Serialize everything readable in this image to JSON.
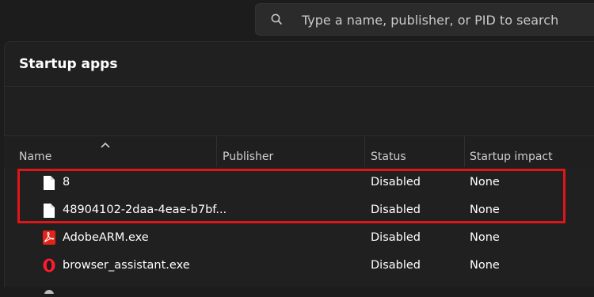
{
  "search": {
    "placeholder": "Type a name, publisher, or PID to search"
  },
  "page": {
    "title": "Startup apps"
  },
  "columns": [
    "Name",
    "Publisher",
    "Status",
    "Startup impact"
  ],
  "rows": [
    {
      "name": "8",
      "publisher": "",
      "status": "Disabled",
      "impact": "None",
      "icon": "file-icon"
    },
    {
      "name": "48904102-2daa-4eae-b7bf...",
      "publisher": "",
      "status": "Disabled",
      "impact": "None",
      "icon": "file-icon"
    },
    {
      "name": "AdobeARM.exe",
      "publisher": "",
      "status": "Disabled",
      "impact": "None",
      "icon": "adobe-acrobat-icon"
    },
    {
      "name": "browser_assistant.exe",
      "publisher": "",
      "status": "Disabled",
      "impact": "None",
      "icon": "opera-icon"
    }
  ],
  "colors": {
    "highlight": "#e0151a",
    "adobe": "#e2231a",
    "opera": "#ff1b2d"
  }
}
